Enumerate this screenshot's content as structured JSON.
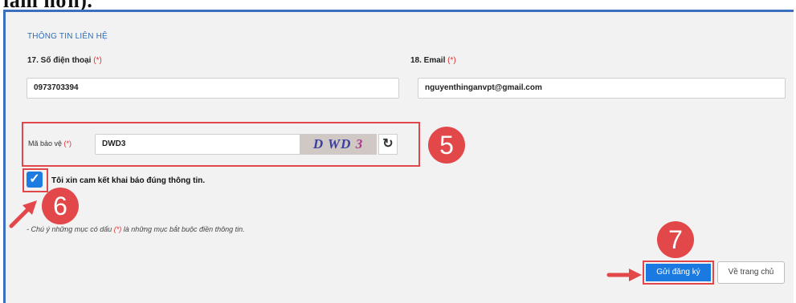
{
  "header_fragment": "làm hơn).",
  "section_title": "THÔNG TIN LIÊN HỆ",
  "phone": {
    "label": "17. Số điện thoại",
    "required_mark": "(*)",
    "value": "0973703394"
  },
  "email": {
    "label": "18. Email",
    "required_mark": "(*)",
    "value": "nguyenthinganvpt@gmail.com"
  },
  "captcha": {
    "label": "Mã bảo vệ",
    "required_mark": "(*)",
    "value": "DWD3",
    "image_text_main": "D WD",
    "image_text_last": "3"
  },
  "commitment": {
    "checked": true,
    "text": "Tôi xin cam kết khai báo đúng thông tin."
  },
  "note": {
    "prefix": "- Chú ý những mục có dấu",
    "mark": "(*)",
    "suffix": "là những mục bắt buộc điền thông tin."
  },
  "steps": {
    "step5": "5",
    "step6": "6",
    "step7": "7"
  },
  "buttons": {
    "submit": "Gửi đăng ký",
    "home": "Về trang chủ"
  },
  "colors": {
    "accent": "#1a7ae2",
    "highlight": "#e2474a",
    "required": "#e03030"
  }
}
